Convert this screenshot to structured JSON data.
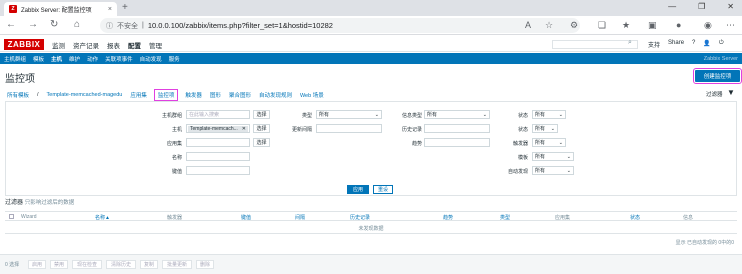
{
  "browser": {
    "tab_title": "Zabbix Server: 配置监控项",
    "tab_favicon": "Z",
    "insecure_label": "不安全",
    "url": "10.0.0.100/zabbix/items.php?filter_set=1&hostid=10282"
  },
  "zabbix": {
    "logo": "ZABBIX",
    "top_menu": [
      "监测",
      "资产记录",
      "报表",
      "配置",
      "管理"
    ],
    "top_menu_selected": "配置",
    "support_label": "支持",
    "share_label": "Share",
    "help_label": "?",
    "sub_menu": [
      "主机群组",
      "模板",
      "主机",
      "维护",
      "动作",
      "关联项事件",
      "自动发现",
      "服务"
    ],
    "sub_menu_selected": "主机",
    "server_label": "Zabbix Server",
    "page_title": "监控项",
    "create_button": "创建监控项",
    "breadcrumbs": [
      "所有模板",
      "Template-memcached-magedu",
      "应用集",
      "监控项",
      "触发器",
      "图形",
      "聚合图形",
      "自动发现规则",
      "Web 场景"
    ],
    "breadcrumb_active": "监控项",
    "filter_label": "过滤器",
    "filter": {
      "host_group_label": "主机群组",
      "host_group_placeholder": "在此输入搜索",
      "select_label": "选择",
      "host_label": "主机",
      "host_tag": "Template-memcach...",
      "app_label": "应用集",
      "name_label": "名称",
      "key_label": "键值",
      "type_label": "类型",
      "type_value": "所有",
      "update_interval_label": "更新间隔",
      "info_type_label": "信息类型",
      "info_type_value": "所有",
      "history_label": "历史记录",
      "trends_label": "趋势",
      "status_label": "状态",
      "status_value": "所有",
      "state_label": "状态",
      "state_value": "所有",
      "trigger_label": "触发器",
      "trigger_value": "所有",
      "template_label": "模板",
      "template_value": "所有",
      "discovery_label": "自动发现",
      "discovery_value": "所有",
      "apply_button": "应用",
      "reset_button": "重设"
    },
    "subfilter_title": "过滤器",
    "subfilter_text": "只影响过滤后的数据",
    "table_headers": [
      "Wizard",
      "名称▲",
      "触发器",
      "键值",
      "间隔",
      "历史记录",
      "趋势",
      "类型",
      "应用集",
      "状态",
      "信息"
    ],
    "no_data": "未发现数据",
    "found_text": "显示 已自动发现的 0中的0",
    "selected_count": "0 选择",
    "actions": [
      "启用",
      "禁用",
      "现在检查",
      "清除历史",
      "复制",
      "批量更新",
      "删除"
    ]
  }
}
